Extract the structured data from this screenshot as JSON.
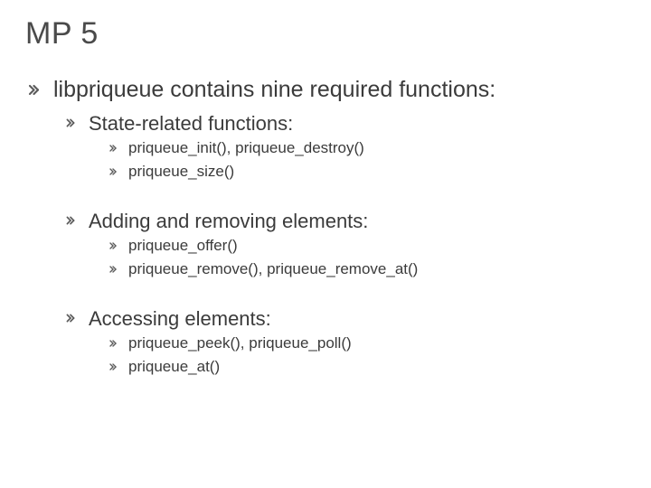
{
  "title": "MP 5",
  "main": {
    "heading": "libpriqueue contains nine required functions:",
    "sections": [
      {
        "label": "State-related functions:",
        "items": [
          "priqueue_init(), priqueue_destroy()",
          "priqueue_size()"
        ]
      },
      {
        "label": "Adding and removing elements:",
        "items": [
          "priqueue_offer()",
          "priqueue_remove(), priqueue_remove_at()"
        ]
      },
      {
        "label": "Accessing elements:",
        "items": [
          "priqueue_peek(), priqueue_poll()",
          "priqueue_at()"
        ]
      }
    ]
  },
  "bullet_glyph": ""
}
